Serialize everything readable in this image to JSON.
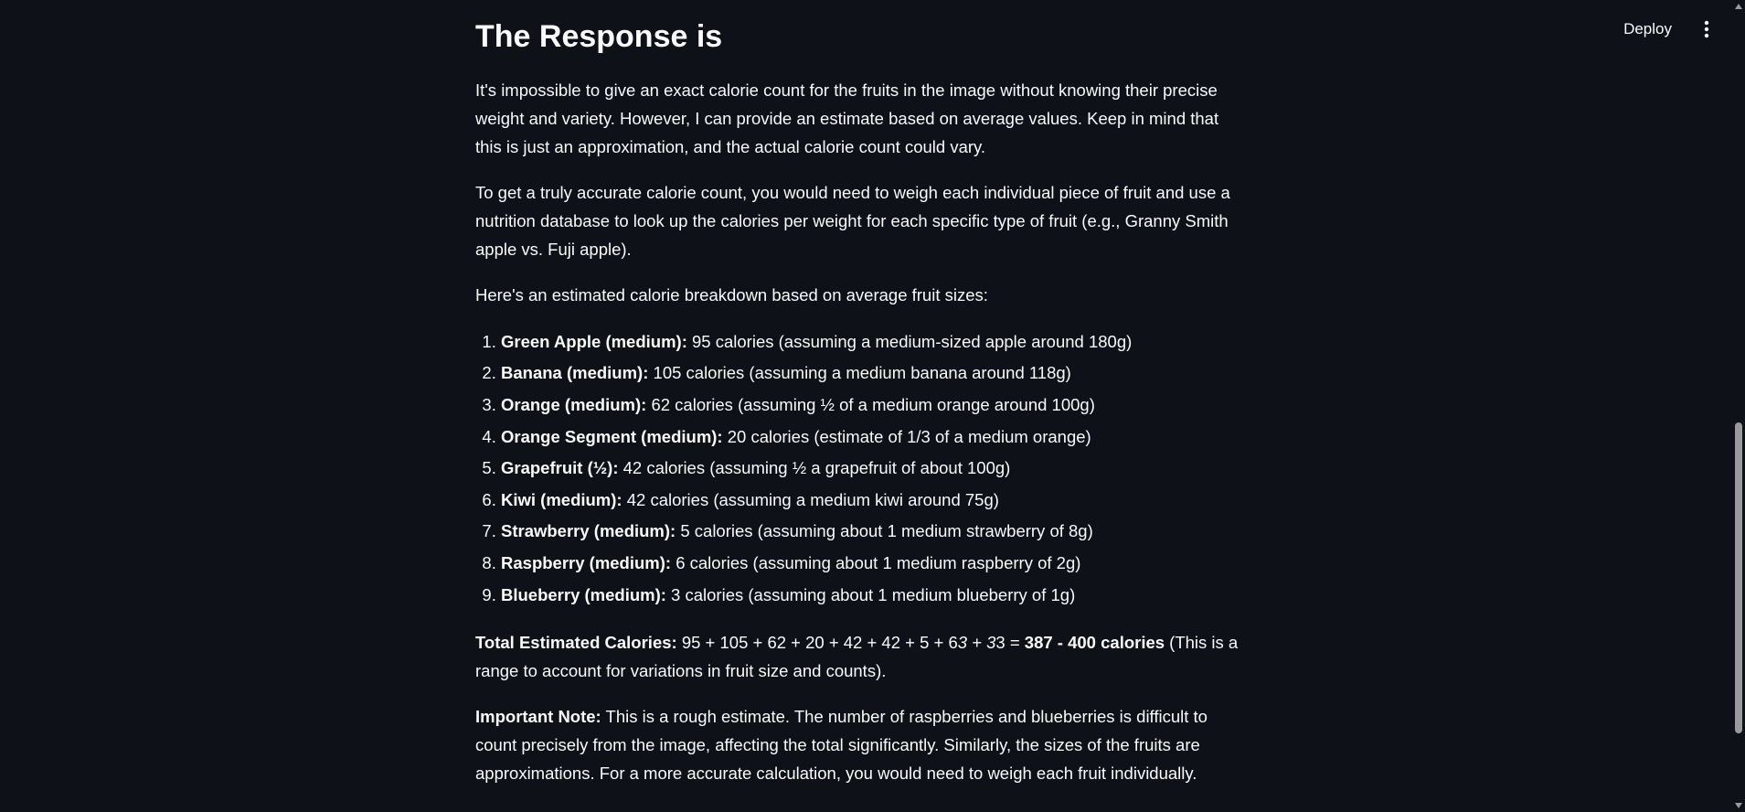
{
  "header": {
    "deploy_label": "Deploy",
    "menu_icon": "vertical-ellipsis-icon"
  },
  "main": {
    "title": "The Response is",
    "paragraph1": "It's impossible to give an exact calorie count for the fruits in the image without knowing their precise weight and variety. However, I can provide an estimate based on average values. Keep in mind that this is just an approximation, and the actual calorie count could vary.",
    "paragraph2": "To get a truly accurate calorie count, you would need to weigh each individual piece of fruit and use a nutrition database to look up the calories per weight for each specific type of fruit (e.g., Granny Smith apple vs. Fuji apple).",
    "paragraph3": "Here's an estimated calorie breakdown based on average fruit sizes:",
    "items": [
      {
        "name": "Green Apple (medium):",
        "desc": " 95 calories (assuming a medium-sized apple around 180g)"
      },
      {
        "name": "Banana (medium):",
        "desc": " 105 calories (assuming a medium banana around 118g)"
      },
      {
        "name": "Orange (medium):",
        "desc": " 62 calories (assuming ½ of a medium orange around 100g)"
      },
      {
        "name": "Orange Segment (medium):",
        "desc": " 20 calories (estimate of 1/3 of a medium orange)"
      },
      {
        "name": "Grapefruit (½):",
        "desc": " 42 calories (assuming ½ a grapefruit of about 100g)"
      },
      {
        "name": "Kiwi (medium):",
        "desc": " 42 calories (assuming a medium kiwi around 75g)"
      },
      {
        "name": "Strawberry (medium):",
        "desc": " 5 calories (assuming about 1 medium strawberry of 8g)"
      },
      {
        "name": "Raspberry (medium):",
        "desc": " 6 calories (assuming about 1 medium raspberry of 2g)"
      },
      {
        "name": "Blueberry (medium):",
        "desc": " 3 calories (assuming about 1 medium blueberry of 1g)"
      }
    ],
    "total": {
      "label": "Total Estimated Calories:",
      "sum_start": " 95 + 105 + 62 + 20 + 42 + 42 + 5 + 6",
      "sum_italic": "3 + 3",
      "sum_end": "3 = ",
      "result": "387 - 400 calories",
      "suffix": " (This is a range to account for variations in fruit size and counts)."
    },
    "note": {
      "label": "Important Note:",
      "text": " This is a rough estimate. The number of raspberries and blueberries is difficult to count precisely from the image, affecting the total significantly. Similarly, the sizes of the fruits are approximations. For a more accurate calculation, you would need to weigh each fruit individually."
    }
  },
  "colors": {
    "background": "#0e1117",
    "text": "#fafafa",
    "scrollbar": "#9a9a9a"
  }
}
